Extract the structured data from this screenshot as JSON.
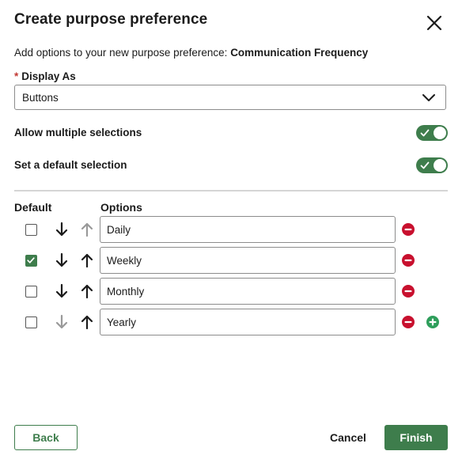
{
  "dialog": {
    "title": "Create purpose preference",
    "subtitle_prefix": "Add options to your new purpose preference:",
    "subtitle_name": "Communication Frequency"
  },
  "display_as": {
    "required_mark": "*",
    "label": "Display As",
    "value": "Buttons"
  },
  "toggles": {
    "multiple_label": "Allow multiple selections",
    "multiple_on": true,
    "default_label": "Set a default selection",
    "default_on": true
  },
  "options_table": {
    "default_header": "Default",
    "options_header": "Options",
    "rows": [
      {
        "value": "Daily",
        "checked": false,
        "down_enabled": true,
        "up_enabled": false
      },
      {
        "value": "Weekly",
        "checked": true,
        "down_enabled": true,
        "up_enabled": true
      },
      {
        "value": "Monthly",
        "checked": false,
        "down_enabled": true,
        "up_enabled": true
      },
      {
        "value": "Yearly",
        "checked": false,
        "down_enabled": false,
        "up_enabled": true
      }
    ]
  },
  "footer": {
    "back_label": "Back",
    "cancel_label": "Cancel",
    "finish_label": "Finish"
  },
  "colors": {
    "accent": "#3e7d4c",
    "remove": "#c8102e",
    "add": "#2e9e5b",
    "disabled_arrow": "#9a9a9a",
    "required": "#c23934"
  },
  "icons": {
    "close": "close-icon",
    "select": "chevron-down-icon",
    "down": "arrow-down-icon",
    "up": "arrow-up-icon",
    "remove": "remove-circle-icon",
    "add": "add-circle-icon",
    "toggle_check": "check-icon"
  }
}
